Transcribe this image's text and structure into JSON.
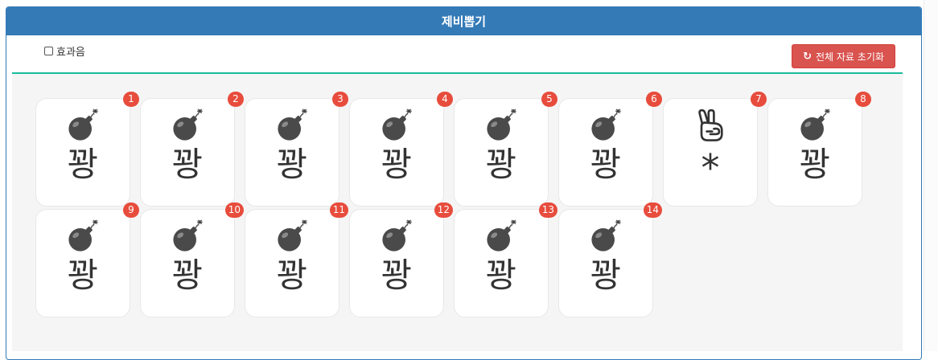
{
  "header": {
    "title": "제비뽑기"
  },
  "controls": {
    "sound_label": "효과음",
    "sound_checked": false,
    "reset_label": "전체 자료 초기화"
  },
  "cards": [
    {
      "number": "1",
      "text": "꽝",
      "icon": "bomb-icon"
    },
    {
      "number": "2",
      "text": "꽝",
      "icon": "bomb-icon"
    },
    {
      "number": "3",
      "text": "꽝",
      "icon": "bomb-icon"
    },
    {
      "number": "4",
      "text": "꽝",
      "icon": "bomb-icon"
    },
    {
      "number": "5",
      "text": "꽝",
      "icon": "bomb-icon"
    },
    {
      "number": "6",
      "text": "꽝",
      "icon": "bomb-icon"
    },
    {
      "number": "7",
      "text": "*",
      "icon": "victory-hand-icon"
    },
    {
      "number": "8",
      "text": "꽝",
      "icon": "bomb-icon"
    },
    {
      "number": "9",
      "text": "꽝",
      "icon": "bomb-icon"
    },
    {
      "number": "10",
      "text": "꽝",
      "icon": "bomb-icon"
    },
    {
      "number": "11",
      "text": "꽝",
      "icon": "bomb-icon"
    },
    {
      "number": "12",
      "text": "꽝",
      "icon": "bomb-icon"
    },
    {
      "number": "13",
      "text": "꽝",
      "icon": "bomb-icon"
    },
    {
      "number": "14",
      "text": "꽝",
      "icon": "bomb-icon"
    }
  ],
  "colors": {
    "header": "#337ab7",
    "reset_button": "#d9534f",
    "divider": "#1abc9c",
    "badge": "#e74c3c",
    "board": "#f5f5f5"
  }
}
